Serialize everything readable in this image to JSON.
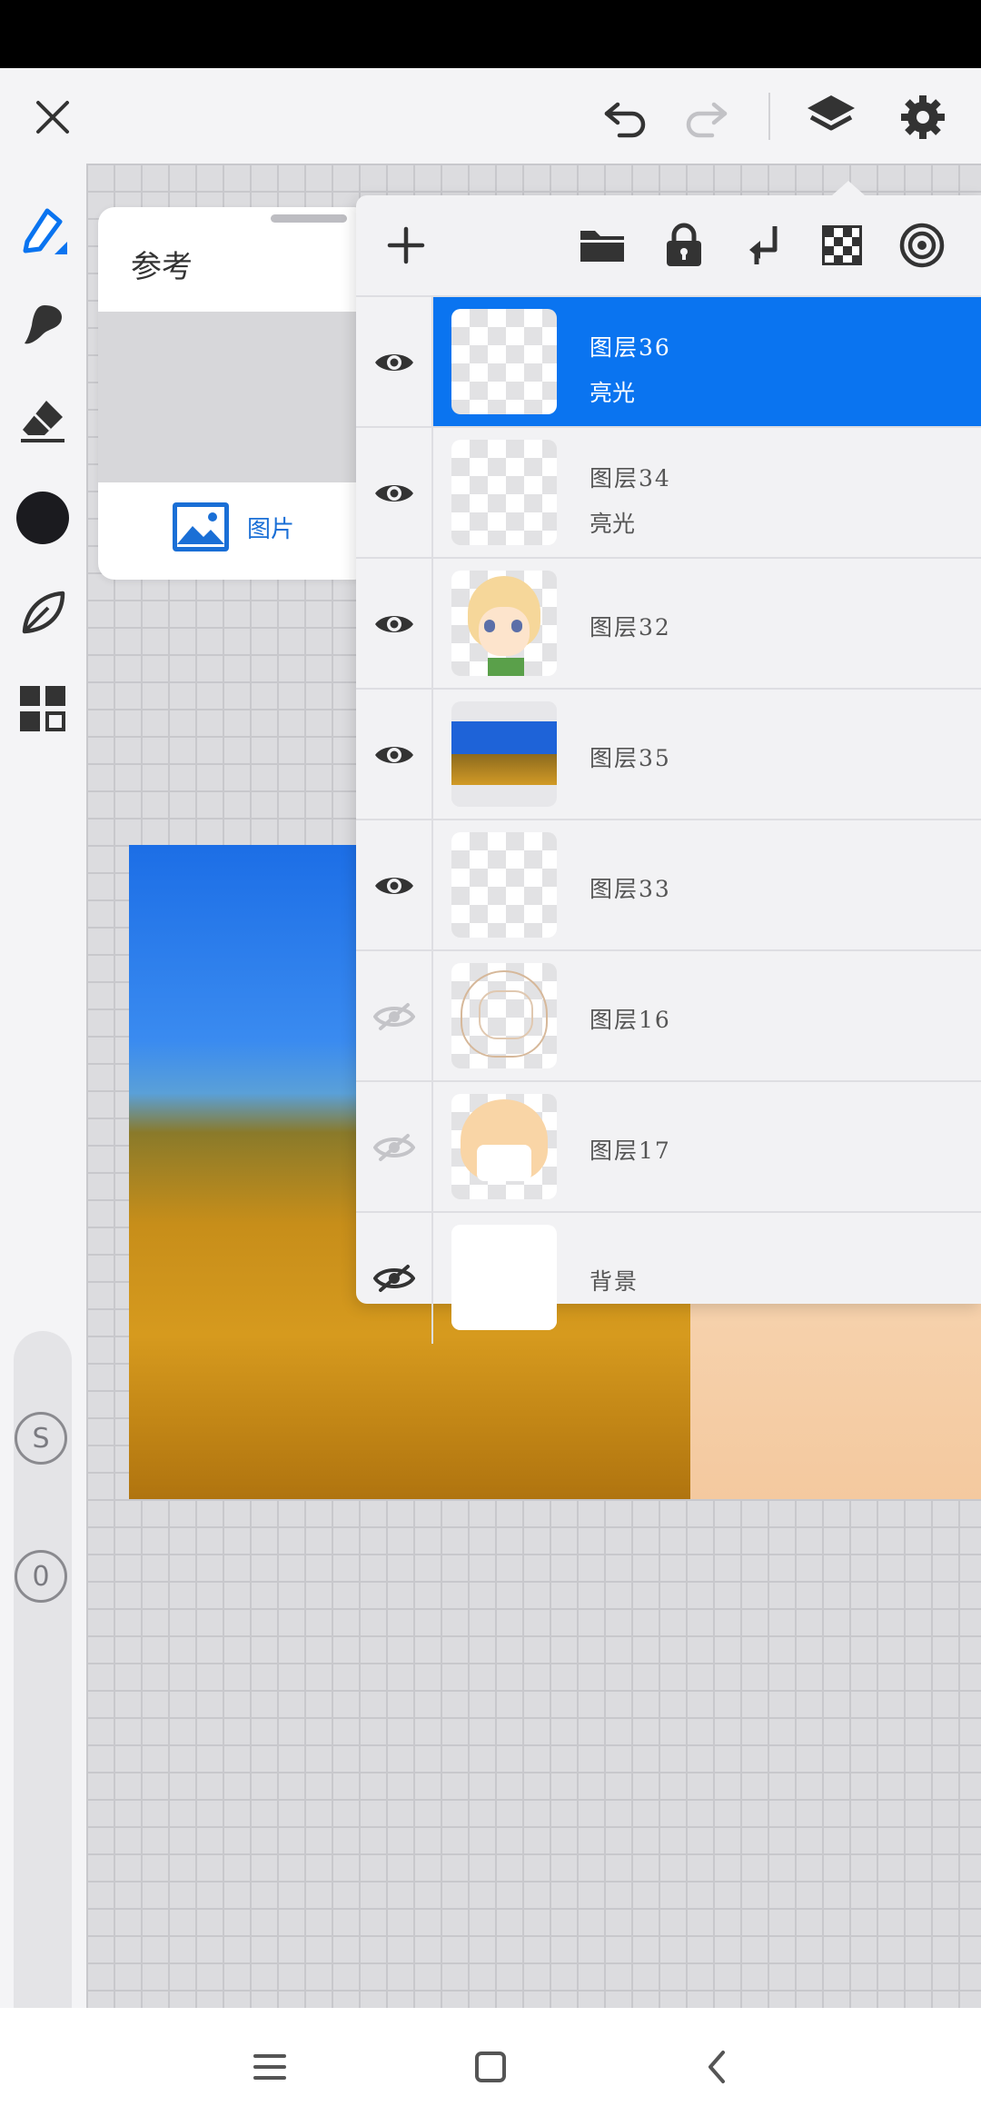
{
  "toolbar": {
    "close_icon": "close-icon",
    "undo_icon": "undo-icon",
    "redo_icon": "redo-icon",
    "layers_icon": "layers-icon",
    "settings_icon": "gear-icon"
  },
  "left_toolbar": {
    "tools": [
      "pen-icon",
      "brush-icon",
      "eraser-icon",
      "color-swatch",
      "leaf-icon",
      "grid-icon"
    ],
    "active_color": "#1b1b1f",
    "size_badge": "S",
    "opacity_badge": "0"
  },
  "reference_panel": {
    "title": "参考",
    "tab_label": "图片"
  },
  "layers_panel": {
    "toolbar": [
      "add-icon",
      "folder-icon",
      "lock-icon",
      "merge-down-icon",
      "checker-icon",
      "target-icon"
    ],
    "layers": [
      {
        "name": "图层36",
        "mode": "亮光",
        "visible": true,
        "selected": true,
        "thumb": "transparent"
      },
      {
        "name": "图层34",
        "mode": "亮光",
        "visible": true,
        "selected": false,
        "thumb": "transparent"
      },
      {
        "name": "图层32",
        "mode": "",
        "visible": true,
        "selected": false,
        "thumb": "character"
      },
      {
        "name": "图层35",
        "mode": "",
        "visible": true,
        "selected": false,
        "thumb": "wheat"
      },
      {
        "name": "图层33",
        "mode": "",
        "visible": true,
        "selected": false,
        "thumb": "transparent"
      },
      {
        "name": "图层16",
        "mode": "",
        "visible": false,
        "selected": false,
        "thumb": "sketch"
      },
      {
        "name": "图层17",
        "mode": "",
        "visible": false,
        "selected": false,
        "thumb": "hair"
      },
      {
        "name": "背景",
        "mode": "",
        "visible": false,
        "selected": false,
        "thumb": "white"
      }
    ],
    "accent": "#0a74f0"
  },
  "nav_bar": {
    "buttons": [
      "menu-icon",
      "home-icon",
      "back-icon"
    ]
  }
}
